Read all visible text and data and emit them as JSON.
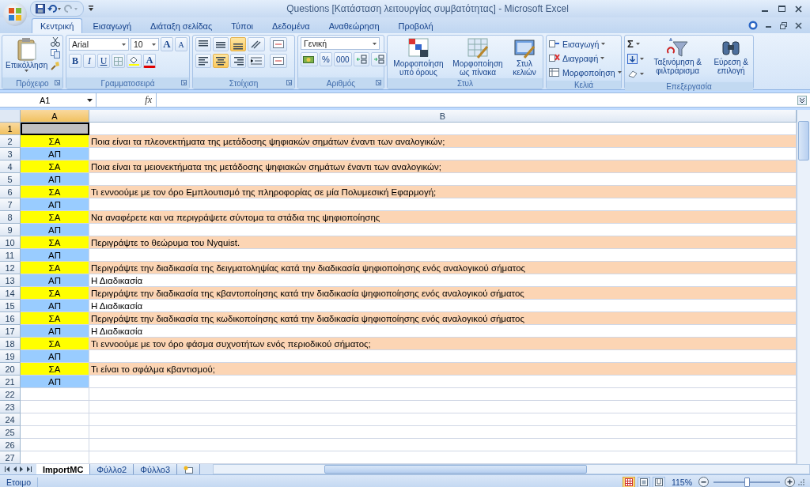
{
  "window": {
    "title": "Questions  [Κατάσταση λειτουργίας συμβατότητας] - Microsoft Excel"
  },
  "tabs": [
    {
      "label": "Κεντρική",
      "selected": true
    },
    {
      "label": "Εισαγωγή",
      "selected": false
    },
    {
      "label": "Διάταξη σελίδας",
      "selected": false
    },
    {
      "label": "Τύποι",
      "selected": false
    },
    {
      "label": "Δεδομένα",
      "selected": false
    },
    {
      "label": "Αναθεώρηση",
      "selected": false
    },
    {
      "label": "Προβολή",
      "selected": false
    }
  ],
  "ribbon": {
    "clipboard": {
      "label": "Πρόχειρο",
      "paste": "Επικόλληση"
    },
    "font": {
      "label": "Γραμματοσειρά",
      "font_name": "Arial",
      "font_size": "10",
      "grow": "A",
      "shrink": "A",
      "bold": "B",
      "italic": "I",
      "underline": "U",
      "font_color": "A"
    },
    "alignment": {
      "label": "Στοίχιση",
      "vertical": [
        {
          "kind": "top",
          "on": false
        },
        {
          "kind": "middle",
          "on": false
        },
        {
          "kind": "bottom",
          "on": true
        }
      ],
      "horizontal": [
        {
          "kind": "left",
          "on": false
        },
        {
          "kind": "center",
          "on": true
        },
        {
          "kind": "right",
          "on": false
        }
      ]
    },
    "number": {
      "label": "Αριθμός",
      "format": "Γενική",
      "percent": "%",
      "thousands": "000"
    },
    "styles": {
      "label": "Στυλ",
      "buttons": [
        {
          "kind": "conditional",
          "text": "Μορφοποίηση υπό όρους"
        },
        {
          "kind": "table",
          "text": "Μορφοποίηση ως πίνακα"
        },
        {
          "kind": "cell",
          "text": "Στυλ κελιών"
        }
      ]
    },
    "cells": {
      "label": "Κελιά",
      "buttons": [
        {
          "kind": "insert",
          "text": "Εισαγωγή"
        },
        {
          "kind": "delete",
          "text": "Διαγραφή"
        },
        {
          "kind": "format",
          "text": "Μορφοποίηση"
        }
      ]
    },
    "editing": {
      "label": "Επεξεργασία",
      "sum": "Σ",
      "buttons": [
        {
          "kind": "sort",
          "text": "Ταξινόμηση & φιλτράρισμα"
        },
        {
          "kind": "find",
          "text": "Εύρεση & επιλογή"
        }
      ]
    }
  },
  "formula_bar": {
    "name_box": "A1",
    "fx": "fx"
  },
  "sheet": {
    "columns": [
      "A",
      "B"
    ],
    "rows": [
      {
        "number": "1",
        "kind": "empty",
        "selected": true
      },
      {
        "number": "2",
        "kind": "question",
        "a": "ΣΑ",
        "b": "Ποια είναι τα πλεονεκτήματα της μετάδοσης ψηφιακών σημάτων έναντι των αναλογικών;",
        "selected": false
      },
      {
        "number": "3",
        "kind": "answer",
        "a": "ΑΠ",
        "selected": false
      },
      {
        "number": "4",
        "kind": "question",
        "a": "ΣΑ",
        "b": "Ποια είναι τα μειονεκτήματα της μετάδοσης ψηφιακών σημάτων έναντι των αναλογικών;",
        "selected": false
      },
      {
        "number": "5",
        "kind": "answer",
        "a": "ΑΠ",
        "selected": false
      },
      {
        "number": "6",
        "kind": "question",
        "a": "ΣΑ",
        "b": "Τι εννοούμε με τον όρο Εμπλουτισμό της πληροφορίας σε μία Πολυμεσική Εφαρμογή;",
        "selected": false
      },
      {
        "number": "7",
        "kind": "answer",
        "a": "ΑΠ",
        "selected": false
      },
      {
        "number": "8",
        "kind": "question",
        "a": "ΣΑ",
        "b": "Να αναφέρετε και να περιγράψετε σύντομα τα στάδια της ψηφιοποίησης",
        "selected": false
      },
      {
        "number": "9",
        "kind": "answer",
        "a": "ΑΠ",
        "selected": false
      },
      {
        "number": "10",
        "kind": "question",
        "a": "ΣΑ",
        "b": "Περιγράψτε το θεώρυμα του Nyquist.",
        "selected": false
      },
      {
        "number": "11",
        "kind": "answer",
        "a": "ΑΠ",
        "selected": false
      },
      {
        "number": "12",
        "kind": "question",
        "a": "ΣΑ",
        "b": "Περιγράψτε την διαδικασία της δειγματοληψίας κατά την διαδικασία ψηφιοποίησης ενός αναλογικού σήματος",
        "selected": false
      },
      {
        "number": "13",
        "kind": "answer",
        "a": "ΑΠ",
        "b": "Η Διαδικασία",
        "selected": false
      },
      {
        "number": "14",
        "kind": "question",
        "a": "ΣΑ",
        "b": "Περιγράψτε την διαδικασία της κβαντοποίησης κατά την διαδικασία ψηφιοποίησης ενός αναλογικού σήματος",
        "selected": false
      },
      {
        "number": "15",
        "kind": "answer",
        "a": "ΑΠ",
        "b": "Η Διαδικασία",
        "selected": false
      },
      {
        "number": "16",
        "kind": "question",
        "a": "ΣΑ",
        "b": "Περιγράψτε την διαδικασία της κωδικοποίησης κατά την διαδικασία ψηφιοποίησης ενός αναλογικού σήματος",
        "selected": false
      },
      {
        "number": "17",
        "kind": "answer",
        "a": "ΑΠ",
        "b": "Η Διαδικασία",
        "selected": false
      },
      {
        "number": "18",
        "kind": "question",
        "a": "ΣΑ",
        "b": "Τι εννοούμε με τον όρο φάσμα συχνοτήτων ενός περιοδικού σήματος;",
        "selected": false
      },
      {
        "number": "19",
        "kind": "answer",
        "a": "ΑΠ",
        "selected": false
      },
      {
        "number": "20",
        "kind": "question",
        "a": "ΣΑ",
        "b": "Τι είναι το σφάλμα κβαντισμού;",
        "selected": false
      },
      {
        "number": "21",
        "kind": "answer",
        "a": "ΑΠ",
        "selected": false
      },
      {
        "number": "22",
        "kind": "empty",
        "selected": false
      },
      {
        "number": "23",
        "kind": "empty",
        "selected": false
      },
      {
        "number": "24",
        "kind": "empty",
        "selected": false
      },
      {
        "number": "25",
        "kind": "empty",
        "selected": false
      },
      {
        "number": "26",
        "kind": "empty",
        "selected": false
      },
      {
        "number": "27",
        "kind": "empty",
        "selected": false
      }
    ]
  },
  "sheet_tabs": [
    {
      "label": "ImportMC",
      "selected": true
    },
    {
      "label": "Φύλλο2",
      "selected": false
    },
    {
      "label": "Φύλλο3",
      "selected": false
    }
  ],
  "status_bar": {
    "text": "Ετοιμο",
    "views": [
      {
        "kind": "normal",
        "selected": true
      },
      {
        "kind": "layout",
        "selected": false
      },
      {
        "kind": "break",
        "selected": false
      }
    ],
    "zoom": "115%",
    "zoom_slider": {
      "level": 0.5
    }
  }
}
